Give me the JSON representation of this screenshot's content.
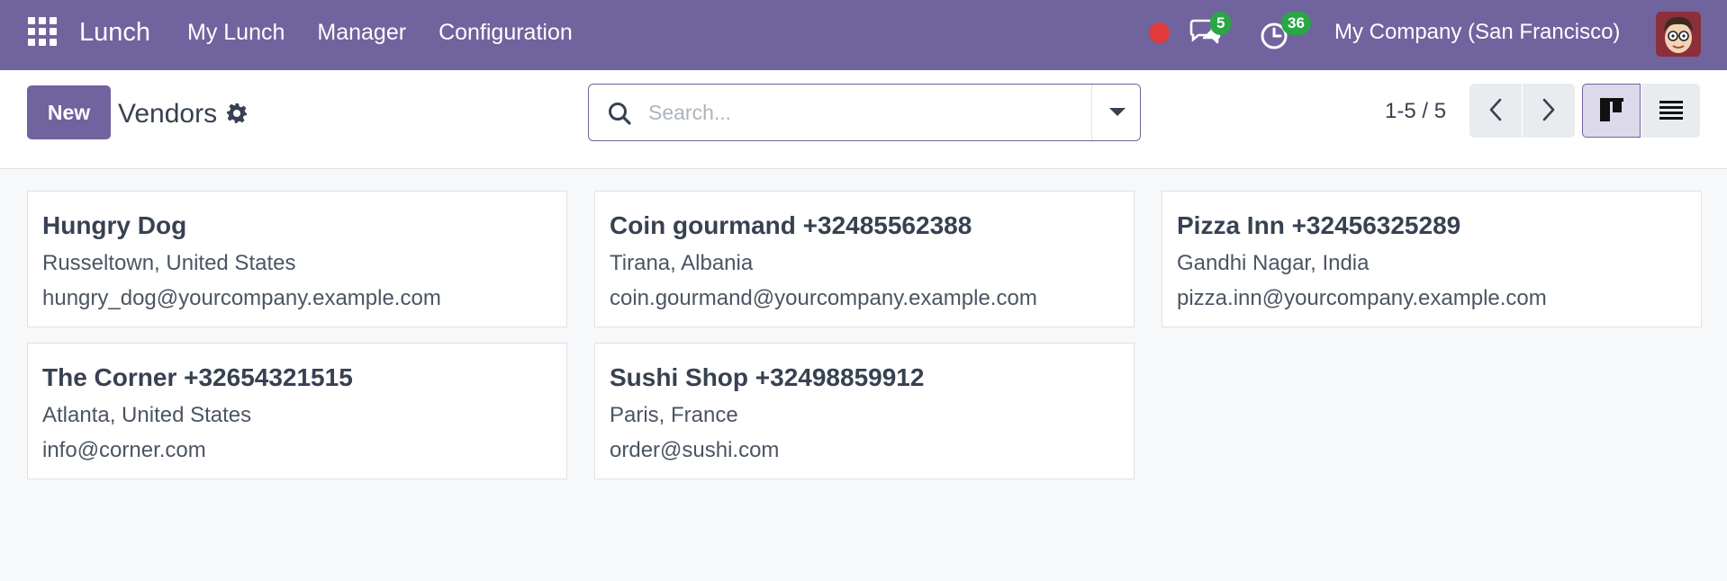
{
  "navbar": {
    "brand": "Lunch",
    "menu": [
      "My Lunch",
      "Manager",
      "Configuration"
    ],
    "messages_count": "5",
    "activities_count": "36",
    "company": "My Company (San Francisco)"
  },
  "control": {
    "new_label": "New",
    "title": "Vendors",
    "search_placeholder": "Search...",
    "pager": "1-5 / 5"
  },
  "vendors": [
    {
      "name": "Hungry Dog",
      "location": "Russeltown, United States",
      "email": "hungry_dog@yourcompany.example.com"
    },
    {
      "name": "Coin gourmand +32485562388",
      "location": "Tirana, Albania",
      "email": "coin.gourmand@yourcompany.example.com"
    },
    {
      "name": "Pizza Inn +32456325289",
      "location": "Gandhi Nagar, India",
      "email": "pizza.inn@yourcompany.example.com"
    },
    {
      "name": "The Corner +32654321515",
      "location": "Atlanta, United States",
      "email": "info@corner.com"
    },
    {
      "name": "Sushi Shop +32498859912",
      "location": "Paris, France",
      "email": "order@sushi.com"
    }
  ],
  "colors": {
    "brand": "#71639e",
    "badge": "#28a745",
    "record_dot": "#e03a3a"
  },
  "icons": [
    "apps-grid-icon",
    "chat-icon",
    "clock-icon",
    "gear-icon",
    "search-icon",
    "chevron-left-icon",
    "chevron-right-icon",
    "kanban-view-icon",
    "list-view-icon"
  ]
}
